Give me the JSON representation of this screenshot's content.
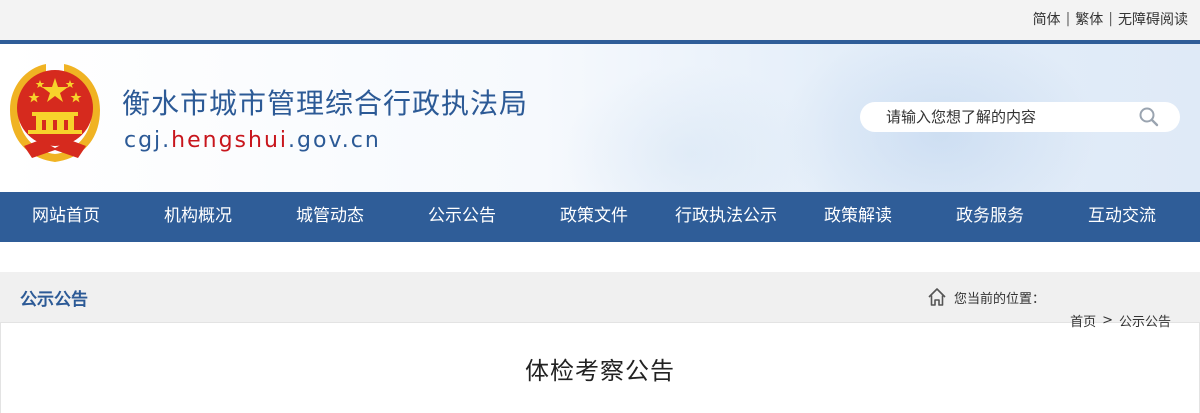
{
  "topbar": {
    "simplified": "简体",
    "traditional": "繁体",
    "accessibility": "无障碍阅读"
  },
  "header": {
    "title": "衡水市城市管理综合行政执法局",
    "domain_prefix": "cgj.",
    "domain_highlight": "hengshui",
    "domain_suffix": ".gov.cn",
    "search_placeholder": "请输入您想了解的内容"
  },
  "nav": {
    "items": [
      {
        "label": "网站首页"
      },
      {
        "label": "机构概况"
      },
      {
        "label": "城管动态"
      },
      {
        "label": "公示公告"
      },
      {
        "label": "政策文件"
      },
      {
        "label": "行政执法公示"
      },
      {
        "label": "政策解读"
      },
      {
        "label": "政务服务"
      },
      {
        "label": "互动交流"
      }
    ]
  },
  "section": {
    "title": "公示公告",
    "location_label": "您当前的位置："
  },
  "breadcrumb": {
    "home": "首页",
    "separator": ">",
    "current": "公示公告"
  },
  "article": {
    "title": "体检考察公告"
  },
  "colors": {
    "brand_blue": "#2f5d98",
    "title_blue": "#2c5a96",
    "domain_red": "#c8161d"
  }
}
